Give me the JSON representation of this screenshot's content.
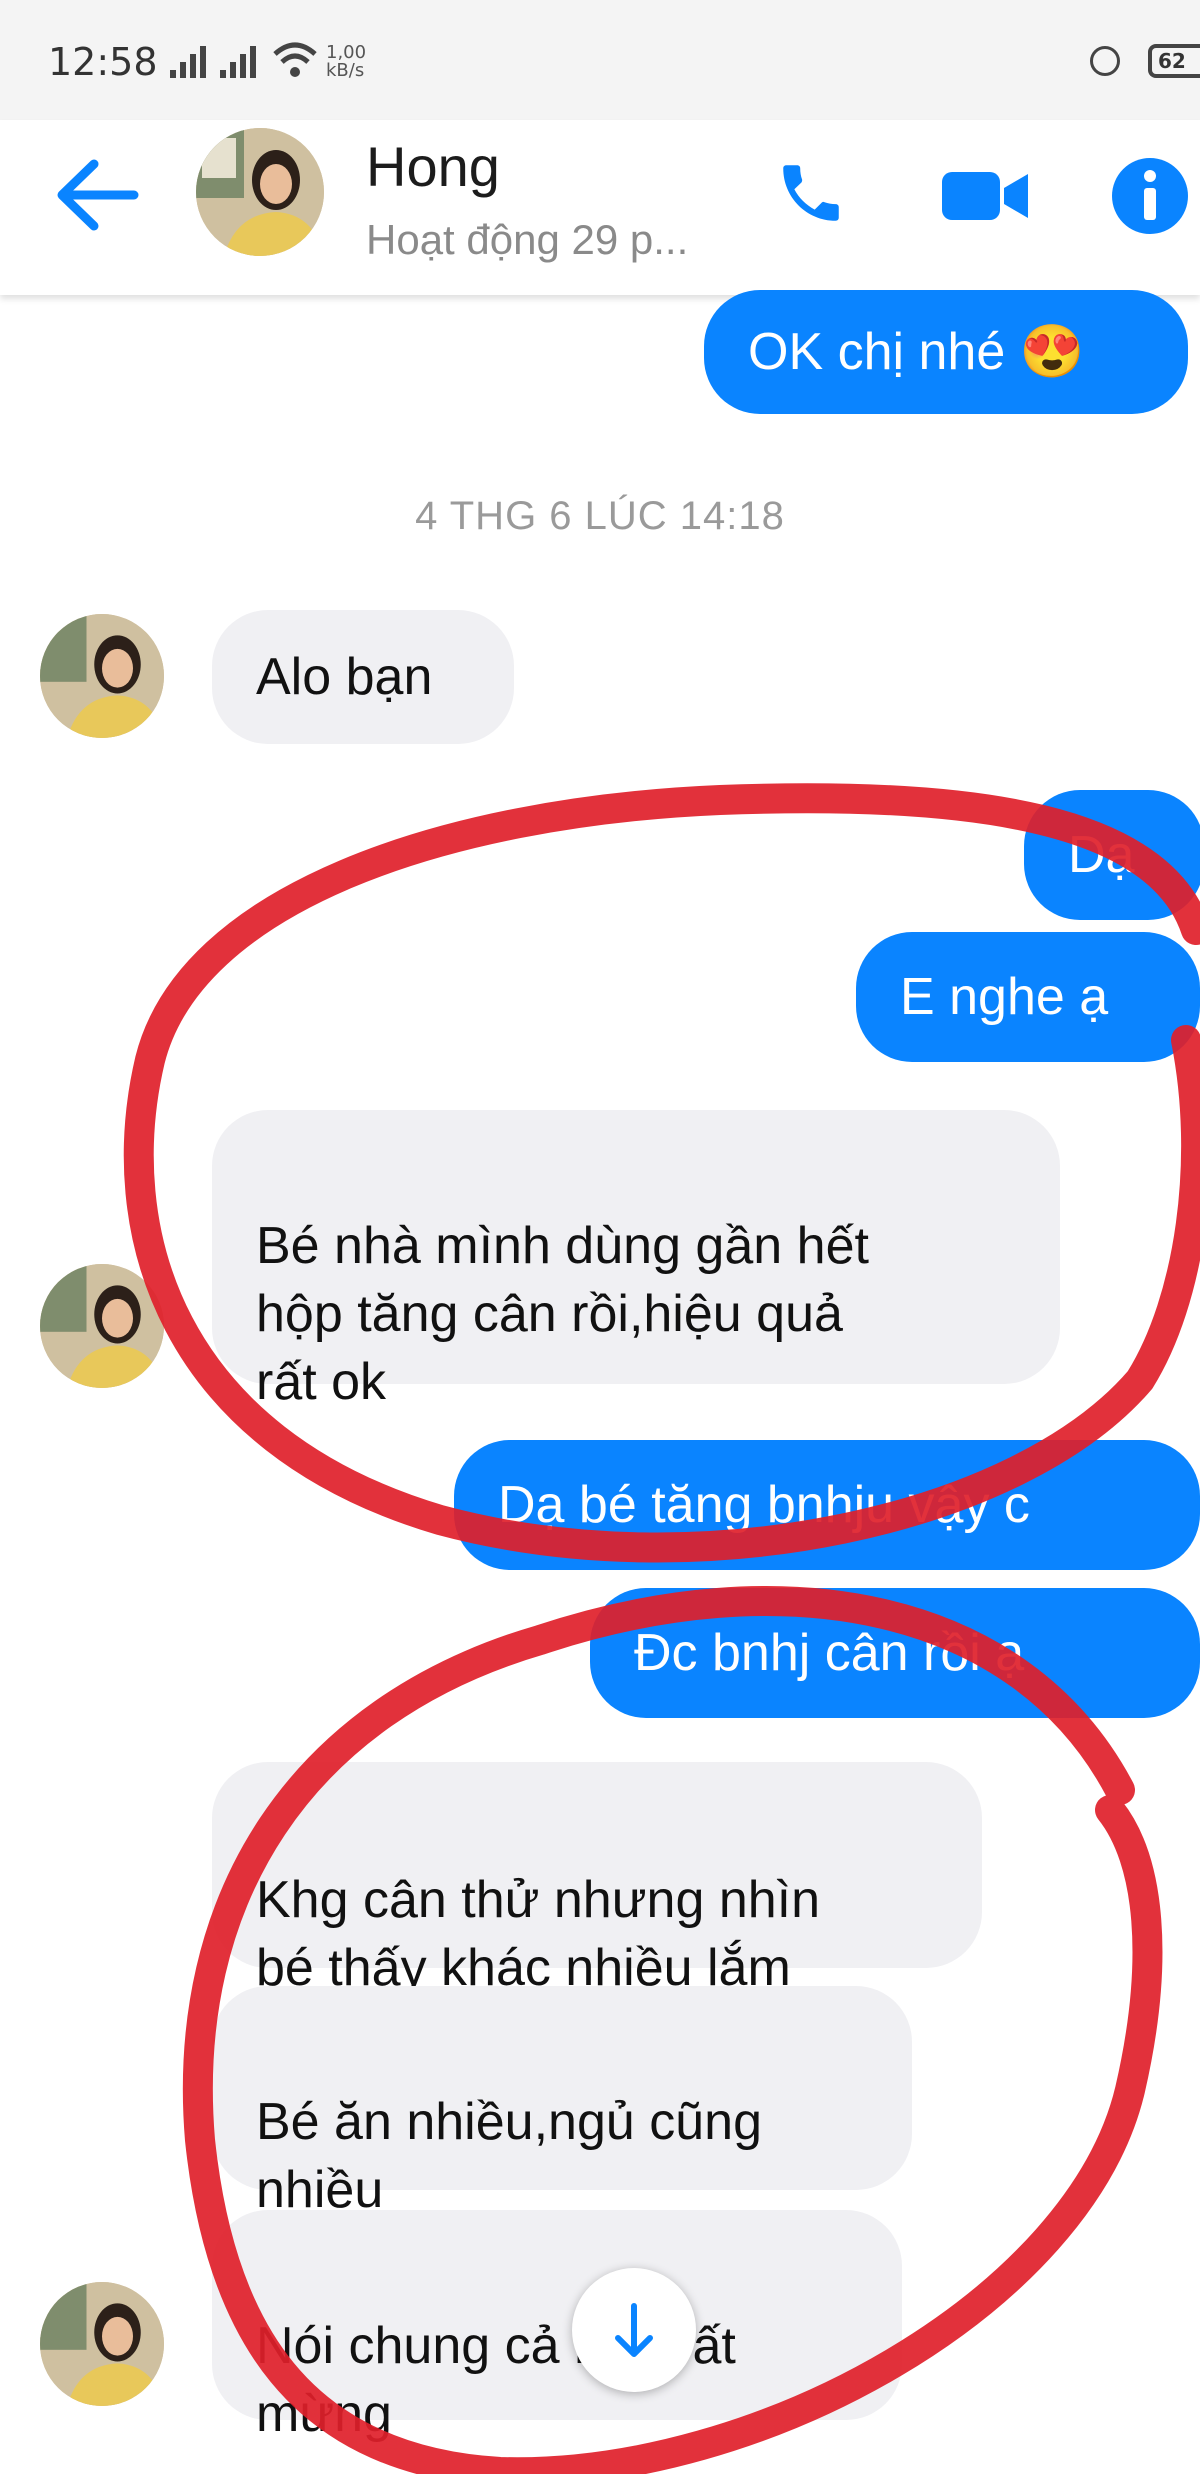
{
  "status_bar": {
    "time": "12:58",
    "network_speed_value": "1,00",
    "network_speed_unit": "kB/s",
    "battery": "62"
  },
  "header": {
    "contact_name": "Hong",
    "activity_status": "Hoạt động 29 p..."
  },
  "icons": {
    "back": "back-arrow-icon",
    "call": "phone-icon",
    "video": "video-camera-icon",
    "info": "info-icon",
    "scroll": "arrow-down-icon"
  },
  "colors": {
    "accent": "#0a84ff",
    "incoming_bubble": "#f0f0f3",
    "annotation": "#e0202a"
  },
  "conversation": {
    "timestamp": "4 THG 6 LÚC 14:18",
    "messages": [
      {
        "side": "out",
        "text": "OK chị nhé 😍"
      },
      {
        "side": "in",
        "text": "Alo bạn"
      },
      {
        "side": "out",
        "text": "Dạ"
      },
      {
        "side": "out",
        "text": "E nghe ạ"
      },
      {
        "side": "in",
        "text": "Bé nhà mình dùng gần hết\nhộp tăng cân rồi,hiệu quả\nrất ok"
      },
      {
        "side": "out",
        "text": "Dạ bé tăng bnhju vậy c"
      },
      {
        "side": "out",
        "text": "Đc bnhj cân rồi ạ"
      },
      {
        "side": "in",
        "text": "Khg cân thử nhưng nhìn\nbé thấy khác nhiều lắm"
      },
      {
        "side": "in",
        "text": "Bé ăn nhiều,ngủ cũng\nnhiều"
      },
      {
        "side": "in",
        "text": "Nói chung cả nhà rất\nmừng"
      }
    ]
  }
}
